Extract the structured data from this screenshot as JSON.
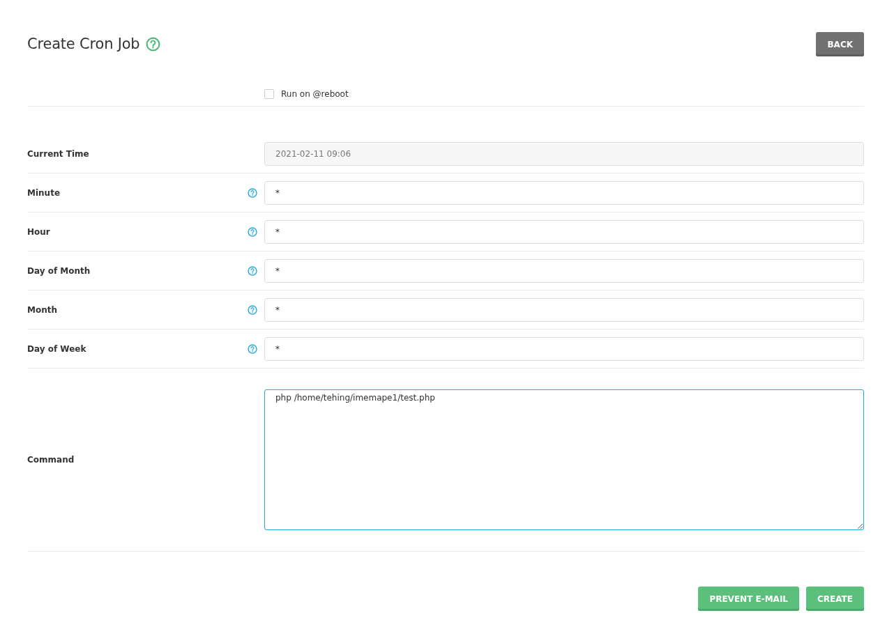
{
  "header": {
    "title": "Create Cron Job",
    "back_button": "BACK"
  },
  "reboot": {
    "label": "Run on @reboot",
    "checked": false
  },
  "fields": [
    {
      "label": "Current Time",
      "value": "2021-02-11 09:06",
      "help": false,
      "disabled": true
    },
    {
      "label": "Minute",
      "value": "*",
      "help": true,
      "disabled": false
    },
    {
      "label": "Hour",
      "value": "*",
      "help": true,
      "disabled": false
    },
    {
      "label": "Day of Month",
      "value": "*",
      "help": true,
      "disabled": false
    },
    {
      "label": "Month",
      "value": "*",
      "help": true,
      "disabled": false
    },
    {
      "label": "Day of Week",
      "value": "*",
      "help": true,
      "disabled": false
    }
  ],
  "command": {
    "label": "Command",
    "value": "php /home/tehing/imemape1/test.php",
    "focused": true
  },
  "buttons": [
    "PREVENT E-MAIL",
    "CREATE"
  ]
}
